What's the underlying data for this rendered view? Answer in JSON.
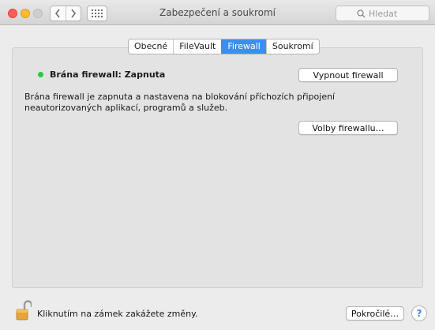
{
  "window": {
    "title": "Zabezpečení a soukromí"
  },
  "toolbar": {
    "back_icon": "chevron-left-icon",
    "forward_icon": "chevron-right-icon",
    "grid_icon": "grid-icon",
    "search_placeholder": "Hledat"
  },
  "tabs": [
    {
      "label": "Obecné",
      "active": false
    },
    {
      "label": "FileVault",
      "active": false
    },
    {
      "label": "Firewall",
      "active": true
    },
    {
      "label": "Soukromí",
      "active": false
    }
  ],
  "firewall": {
    "status_label": "Brána firewall: Zapnuta",
    "status_color": "#28c840",
    "turn_off_label": "Vypnout firewall",
    "description": "Brána firewall je zapnuta a nastavena na blokování příchozích připojení neautorizovaných aplikací, programů a služeb.",
    "options_label": "Volby firewallu…"
  },
  "footer": {
    "lock_text": "Kliknutím na zámek zakážete změny.",
    "advanced_label": "Pokročilé…",
    "help_label": "?"
  },
  "colors": {
    "accent": "#3b8ff2",
    "status_on": "#28c840"
  }
}
